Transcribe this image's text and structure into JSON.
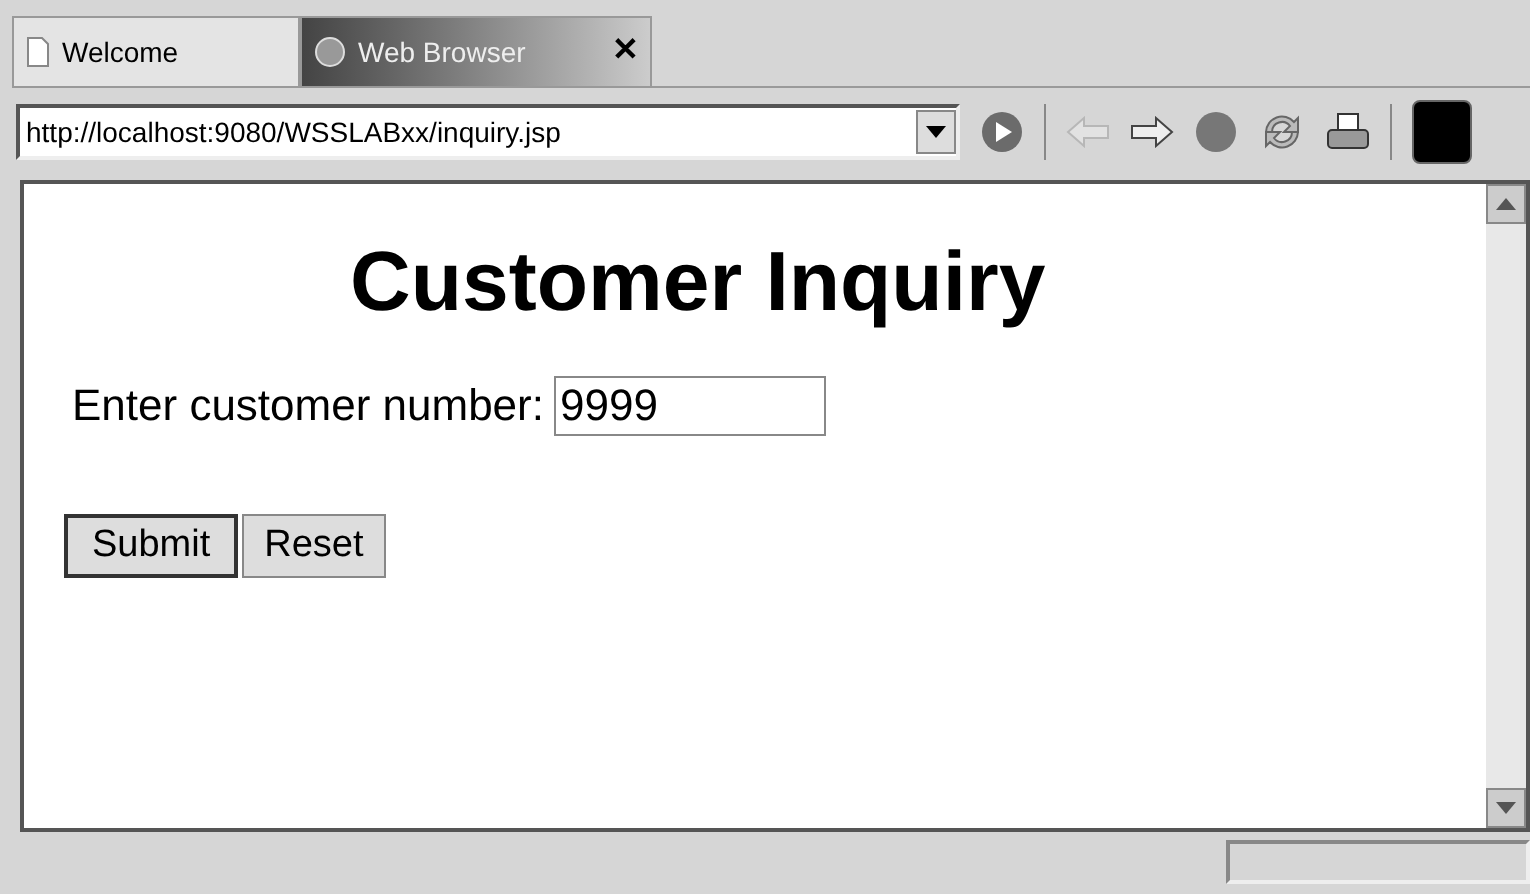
{
  "tabs": [
    {
      "label": "Welcome",
      "selected": false
    },
    {
      "label": "Web Browser",
      "selected": true,
      "close": "✕"
    }
  ],
  "toolbar": {
    "url": "http://localhost:9080/WSSLABxx/inquiry.jsp",
    "back_disabled": true
  },
  "page": {
    "heading": "Customer Inquiry",
    "label": "Enter customer number:",
    "value": "9999",
    "buttons": [
      "Submit",
      "Reset"
    ]
  }
}
